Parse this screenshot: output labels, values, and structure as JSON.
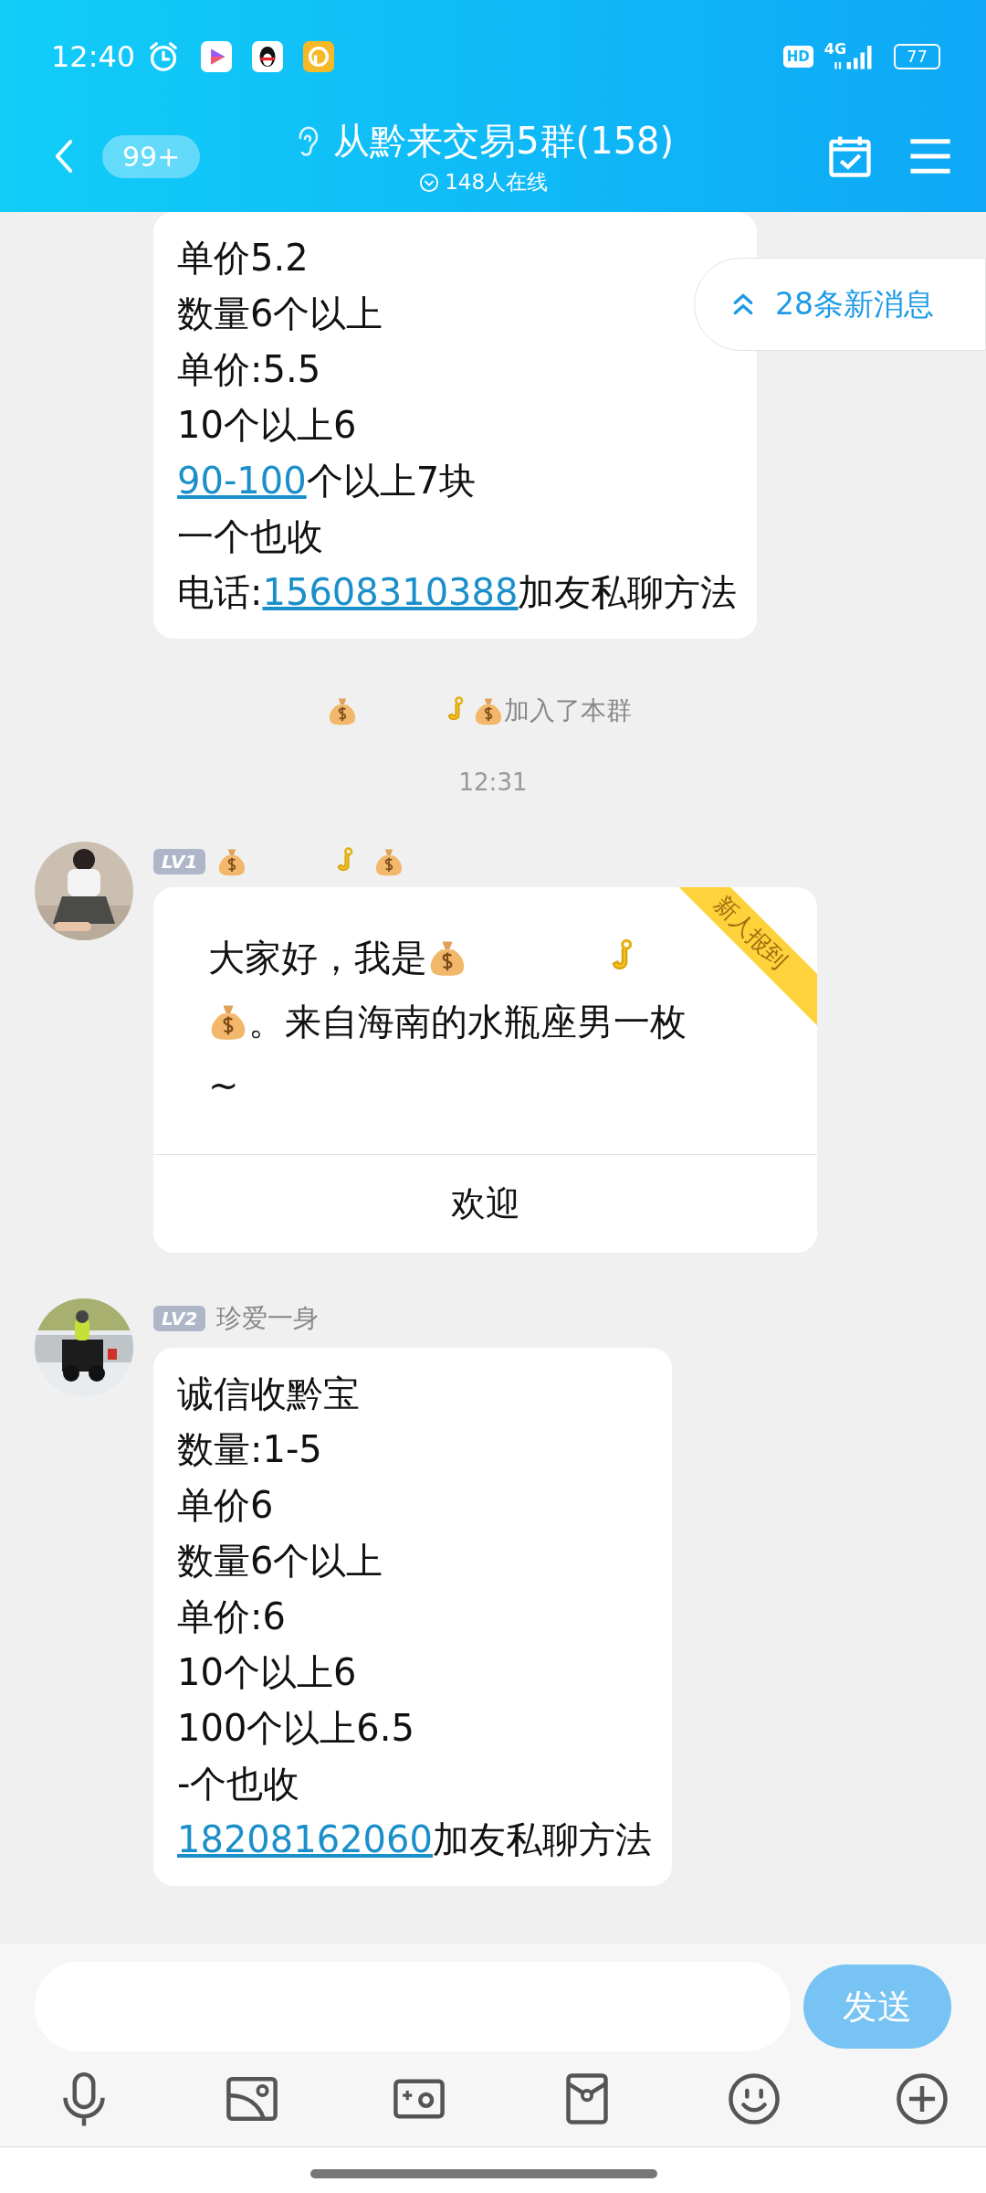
{
  "status_bar": {
    "time": "12:40",
    "hd": "HD",
    "network": "4G",
    "battery": "77"
  },
  "header": {
    "back_badge": "99+",
    "title": "从黔来交易5群(158)",
    "online": "148人在线"
  },
  "new_messages": "28条新消息",
  "messages": [
    {
      "kind": "bubble",
      "lines": [
        [
          {
            "kind": "text",
            "text": "单价5.2"
          }
        ],
        [
          {
            "kind": "text",
            "text": "数量6个以上"
          }
        ],
        [
          {
            "kind": "text",
            "text": "单价:5.5"
          }
        ],
        [
          {
            "kind": "text",
            "text": "10个以上6"
          }
        ],
        [
          {
            "kind": "link",
            "text": "90-100"
          },
          {
            "kind": "text",
            "text": "个以上7块"
          }
        ],
        [
          {
            "kind": "text",
            "text": "一个也收"
          }
        ],
        [
          {
            "kind": "text",
            "text": "电话:"
          },
          {
            "kind": "link",
            "text": "15608310388"
          },
          {
            "kind": "text",
            "text": "加友私聊方法"
          }
        ]
      ]
    },
    {
      "kind": "system",
      "segments": [
        {
          "kind": "money_bag"
        },
        {
          "kind": "hook"
        },
        {
          "kind": "money_bag"
        },
        {
          "kind": "text",
          "text": "加入了本群"
        }
      ]
    },
    {
      "kind": "time",
      "text": "12:31"
    },
    {
      "kind": "card",
      "avatar": {
        "kind": "picture"
      },
      "level": "LV1",
      "sender": [
        {
          "kind": "money_bag"
        },
        {
          "kind": "hook"
        },
        {
          "kind": "money_bag"
        }
      ],
      "ribbon": "新人报到",
      "lines": [
        [
          {
            "kind": "text",
            "text": "大家好，我是"
          },
          {
            "kind": "money_bag"
          },
          {
            "kind": "hook"
          }
        ],
        [
          {
            "kind": "money_bag"
          },
          {
            "kind": "text",
            "text": "。来自海南的水瓶座男一枚"
          }
        ],
        [
          {
            "kind": "text",
            "text": "~"
          }
        ]
      ],
      "button": "欢迎"
    },
    {
      "kind": "bubble",
      "avatar": {
        "kind": "picture"
      },
      "level": "LV2",
      "sender": [
        {
          "kind": "text",
          "text": "珍爱一身"
        }
      ],
      "lines": [
        [
          {
            "kind": "text",
            "text": "诚信收黔宝"
          }
        ],
        [
          {
            "kind": "text",
            "text": "数量:1-5"
          }
        ],
        [
          {
            "kind": "text",
            "text": "单价6"
          }
        ],
        [
          {
            "kind": "text",
            "text": "数量6个以上"
          }
        ],
        [
          {
            "kind": "text",
            "text": "单价:6"
          }
        ],
        [
          {
            "kind": "text",
            "text": "10个以上6"
          }
        ],
        [
          {
            "kind": "text",
            "text": "100个以上6.5"
          }
        ],
        [
          {
            "kind": "text",
            "text": "-个也收"
          }
        ],
        [
          {
            "kind": "link",
            "text": "18208162060"
          },
          {
            "kind": "text",
            "text": "加友私聊方法"
          }
        ]
      ]
    }
  ],
  "send_button": {
    "label": "发送",
    "disabled": true
  }
}
